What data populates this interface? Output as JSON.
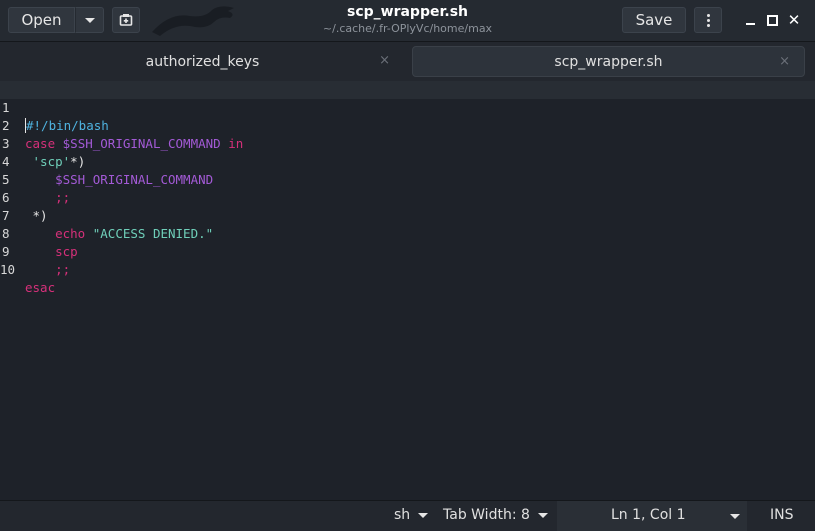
{
  "window": {
    "title": "scp_wrapper.sh",
    "subtitle": "~/.cache/.fr-OPlyVc/home/max"
  },
  "toolbar": {
    "open_label": "Open",
    "save_label": "Save"
  },
  "tabs": [
    {
      "label": "authorized_keys",
      "close": "×",
      "active": false
    },
    {
      "label": "scp_wrapper.sh",
      "close": "×",
      "active": true
    }
  ],
  "editor": {
    "lines": [
      {
        "num": "1"
      },
      {
        "num": "2"
      },
      {
        "num": "3"
      },
      {
        "num": "4"
      },
      {
        "num": "5"
      },
      {
        "num": "6"
      },
      {
        "num": "7"
      },
      {
        "num": "8"
      },
      {
        "num": "9"
      },
      {
        "num": "10"
      }
    ],
    "tokens": {
      "l1": "#!/bin/bash",
      "l2_case": "case",
      "l2_var": "$SSH_ORIGINAL_COMMAND",
      "l2_in": "in",
      "l3_str": "'scp'",
      "l3_op": "*)",
      "l4_var": "$SSH_ORIGINAL_COMMAND",
      "l5_semi": ";;",
      "l6_op": "*)",
      "l7_echo": "echo",
      "l7_str": "\"ACCESS DENIED.\"",
      "l8_cmd": "scp",
      "l9_semi": ";;",
      "l10_esac": "esac"
    }
  },
  "statusbar": {
    "language": "sh",
    "tab_width": "Tab Width: 8",
    "position": "Ln 1, Col 1",
    "mode": "INS"
  },
  "colors": {
    "keyword": "#d6307a",
    "variable": "#a35ad6",
    "string": "#6fcfb9",
    "shebang": "#4fb3e0"
  }
}
